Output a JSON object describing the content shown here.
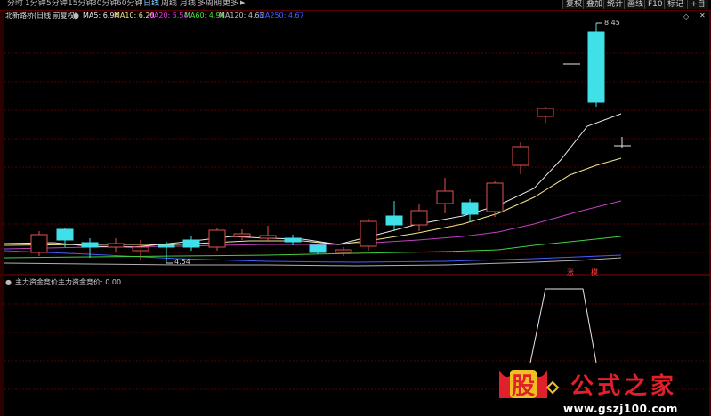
{
  "toolbar": {
    "tabs": [
      "分时",
      "1分钟",
      "5分钟",
      "15分钟",
      "30分钟",
      "60分钟",
      "日线",
      "周线",
      "月线",
      "多周期",
      "更多"
    ],
    "active_tab": "日线",
    "right_buttons": [
      "复权",
      "叠加",
      "统计",
      "画线",
      "F10",
      "标记",
      "+自"
    ]
  },
  "header": {
    "stock_title": "北新路桥(日线 前复权)",
    "ma": [
      {
        "label": "MA5: 6.94",
        "color": "#e8e8e8"
      },
      {
        "label": "MA10: 6.20",
        "color": "#f0e68c"
      },
      {
        "label": "MA20: 5.54",
        "color": "#e040e0"
      },
      {
        "label": "MA60: 4.94",
        "color": "#40e040"
      },
      {
        "label": "MA120: 4.63",
        "color": "#c0c0c0"
      },
      {
        "label": "MA250: 4.67",
        "color": "#4060ff"
      }
    ]
  },
  "price_labels": {
    "high": "8.45",
    "low": "4.54"
  },
  "markers": {
    "left": "涨",
    "right": "模"
  },
  "indicator": {
    "title": "主力资金竞价",
    "value_text": "主力资金竞价: 0.00"
  },
  "logo": {
    "char1": "股",
    "text": "公式之家",
    "url": "www.gszj100.com"
  },
  "colors": {
    "up_candle": "#e05050",
    "down_candle": "#40e0e8",
    "grid": "#5a0000"
  }
}
